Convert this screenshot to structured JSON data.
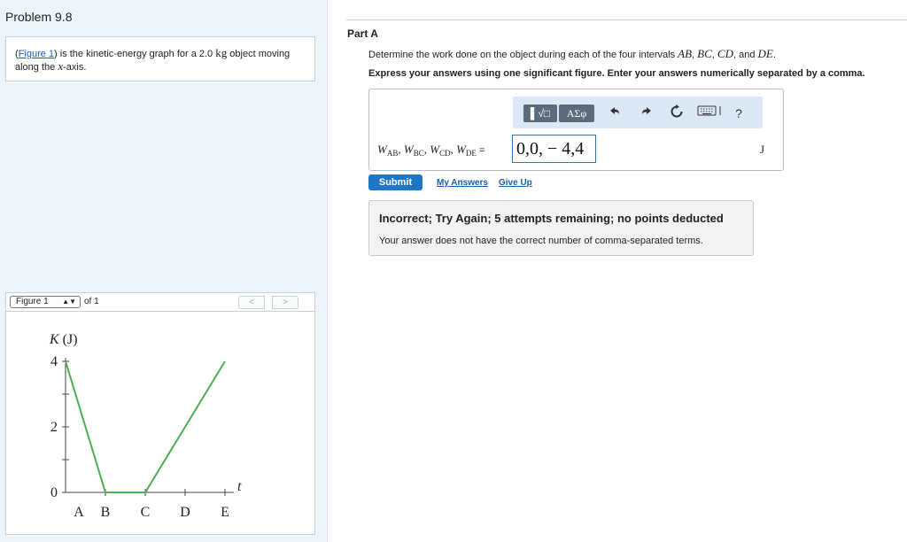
{
  "problem": {
    "title": "Problem 9.8"
  },
  "intro": {
    "figure_link": "Figure 1",
    "paren_open": "(",
    "text_a": ") is the kinetic-energy graph for a 2.0 ",
    "unit": "kg",
    "text_b": " object moving",
    "text_c": "along the ",
    "axis_var": "x",
    "text_d": "-axis."
  },
  "figure_nav": {
    "select_value": "Figure 1",
    "of_label": "of 1",
    "prev_label": "<",
    "next_label": ">"
  },
  "part": {
    "title": "Part A",
    "question_prefix": "Determine the work done on the object during each of the four intervals ",
    "intervals": [
      "AB",
      "BC",
      "CD",
      "DE"
    ],
    "question_suffix": "and ",
    "instruction": "Express your answers using one significant figure. Enter your answers numerically separated by a comma."
  },
  "toolbar": {
    "template_label": "▌√□",
    "symbols_label": "AΣφ",
    "undo_icon": "undo-icon",
    "redo_icon": "redo-icon",
    "reset_icon": "reset-icon",
    "keyboard_icon": "keyboard-icon",
    "help_label": "?"
  },
  "answer": {
    "var": "W",
    "subs": [
      "AB",
      "BC",
      "CD",
      "DE"
    ],
    "equals": "=",
    "value": "0,0, − 4,4",
    "unit": "J"
  },
  "actions": {
    "submit_label": "Submit",
    "my_answers_label": "My Answers",
    "give_up_label": "Give Up"
  },
  "feedback": {
    "title": "Incorrect; Try Again; 5 attempts remaining; no points deducted",
    "detail": "Your answer does not have the correct number of comma-separated terms."
  },
  "colors": {
    "line": "#4caf50",
    "link": "#1a5fa8",
    "submit": "#1e76c7"
  },
  "chart_data": {
    "type": "line",
    "ylabel": "K (J)",
    "y_tick_labels": [
      "0",
      "2",
      "4"
    ],
    "x_tick_labels": [
      "A",
      "B",
      "C",
      "D",
      "E"
    ],
    "x_axis_var": "t",
    "x": [
      "A",
      "B",
      "C",
      "D",
      "E"
    ],
    "series": [
      {
        "values": [
          4,
          0,
          0,
          2,
          4
        ]
      }
    ],
    "ylim": [
      0,
      4
    ],
    "grid": false
  }
}
